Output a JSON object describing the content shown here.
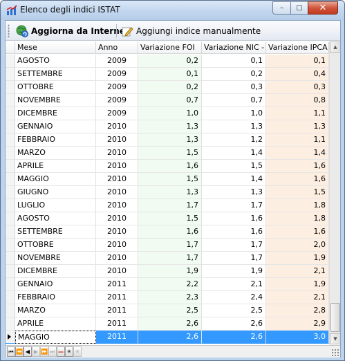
{
  "window": {
    "title": "Elenco degli indici ISTAT",
    "minimize_glyph": "–",
    "maximize_glyph": "□",
    "close_glyph": "✕"
  },
  "toolbar": {
    "update_label": "Aggiorna da Internet",
    "add_manual_label": "Aggiungi indice manualmente"
  },
  "grid": {
    "columns": [
      "Mese",
      "Anno",
      "Variazione FOI",
      "Variazione NIC - ci",
      "Variazione IPCA"
    ],
    "rows": [
      {
        "mese": "AGOSTO",
        "anno": "2009",
        "foi": "0,2",
        "nic": "0,1",
        "ipca": "0,1"
      },
      {
        "mese": "SETTEMBRE",
        "anno": "2009",
        "foi": "0,1",
        "nic": "0,2",
        "ipca": "0,4"
      },
      {
        "mese": "OTTOBRE",
        "anno": "2009",
        "foi": "0,2",
        "nic": "0,3",
        "ipca": "0,3"
      },
      {
        "mese": "NOVEMBRE",
        "anno": "2009",
        "foi": "0,7",
        "nic": "0,7",
        "ipca": "0,8"
      },
      {
        "mese": "DICEMBRE",
        "anno": "2009",
        "foi": "1,0",
        "nic": "1,0",
        "ipca": "1,1"
      },
      {
        "mese": "GENNAIO",
        "anno": "2010",
        "foi": "1,3",
        "nic": "1,3",
        "ipca": "1,3"
      },
      {
        "mese": "FEBBRAIO",
        "anno": "2010",
        "foi": "1,3",
        "nic": "1,2",
        "ipca": "1,1"
      },
      {
        "mese": "MARZO",
        "anno": "2010",
        "foi": "1,5",
        "nic": "1,4",
        "ipca": "1,4"
      },
      {
        "mese": "APRILE",
        "anno": "2010",
        "foi": "1,6",
        "nic": "1,5",
        "ipca": "1,6"
      },
      {
        "mese": "MAGGIO",
        "anno": "2010",
        "foi": "1,5",
        "nic": "1,4",
        "ipca": "1,6"
      },
      {
        "mese": "GIUGNO",
        "anno": "2010",
        "foi": "1,3",
        "nic": "1,3",
        "ipca": "1,5"
      },
      {
        "mese": "LUGLIO",
        "anno": "2010",
        "foi": "1,7",
        "nic": "1,7",
        "ipca": "1,8"
      },
      {
        "mese": "AGOSTO",
        "anno": "2010",
        "foi": "1,5",
        "nic": "1,6",
        "ipca": "1,8"
      },
      {
        "mese": "SETTEMBRE",
        "anno": "2010",
        "foi": "1,6",
        "nic": "1,6",
        "ipca": "1,6"
      },
      {
        "mese": "OTTOBRE",
        "anno": "2010",
        "foi": "1,7",
        "nic": "1,7",
        "ipca": "2,0"
      },
      {
        "mese": "NOVEMBRE",
        "anno": "2010",
        "foi": "1,7",
        "nic": "1,7",
        "ipca": "1,9"
      },
      {
        "mese": "DICEMBRE",
        "anno": "2010",
        "foi": "1,9",
        "nic": "1,9",
        "ipca": "2,1"
      },
      {
        "mese": "GENNAIO",
        "anno": "2011",
        "foi": "2,2",
        "nic": "2,1",
        "ipca": "1,9"
      },
      {
        "mese": "FEBBRAIO",
        "anno": "2011",
        "foi": "2,3",
        "nic": "2,4",
        "ipca": "2,1"
      },
      {
        "mese": "MARZO",
        "anno": "2011",
        "foi": "2,5",
        "nic": "2,5",
        "ipca": "2,8"
      },
      {
        "mese": "APRILE",
        "anno": "2011",
        "foi": "2,6",
        "nic": "2,6",
        "ipca": "2,9"
      },
      {
        "mese": "MAGGIO",
        "anno": "2011",
        "foi": "2,6",
        "nic": "2,6",
        "ipca": "3,0",
        "selected": true
      }
    ]
  },
  "navigator": {
    "buttons": [
      {
        "name": "first-page-button",
        "glyph": "⏮",
        "enabled": true
      },
      {
        "name": "prev-page-button",
        "glyph": "⏪",
        "enabled": true
      },
      {
        "name": "prev-record-button",
        "glyph": "◀",
        "enabled": true
      },
      {
        "name": "next-record-button",
        "glyph": "▶",
        "enabled": false
      },
      {
        "name": "next-page-button",
        "glyph": "⏩",
        "enabled": false
      },
      {
        "name": "last-page-button",
        "glyph": "⏭",
        "enabled": false
      },
      {
        "name": "delete-record-button",
        "glyph": "—",
        "enabled": true,
        "kind": "del"
      },
      {
        "name": "new-record-button",
        "glyph": "✳",
        "enabled": true
      },
      {
        "name": "new-record-star-button",
        "glyph": "✳",
        "enabled": false
      }
    ]
  },
  "colors": {
    "selection": "#3399ff",
    "foi_column": "#f1fbf1",
    "ipca_column": "#fdeee2"
  }
}
